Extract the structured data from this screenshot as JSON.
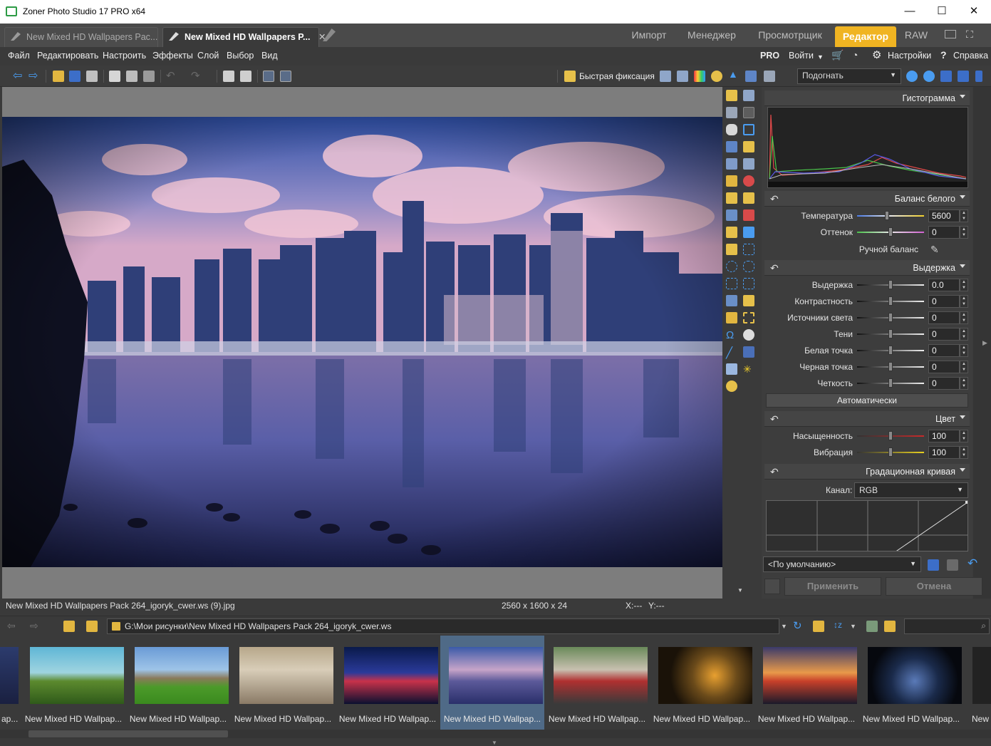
{
  "window": {
    "title": "Zoner Photo Studio 17 PRO x64",
    "minimize": "—",
    "maximize": "☐",
    "close": "✕"
  },
  "doc_tabs": [
    {
      "label": "New Mixed HD Wallpapers Pac..."
    },
    {
      "label": "New Mixed HD Wallpapers P...",
      "close": "✕"
    }
  ],
  "module_tabs": [
    "Импорт",
    "Менеджер",
    "Просмотрщик",
    "Редактор",
    "RAW"
  ],
  "menu": [
    "Файл",
    "Редактировать",
    "Настроить",
    "Эффекты",
    "Слой",
    "Выбор",
    "Вид"
  ],
  "account": {
    "pro": "PRO",
    "login": "Войти",
    "settings": "Настройки",
    "help": "Справка"
  },
  "toolbar": {
    "quick_fix": "Быстрая фиксация",
    "fit_mode": "Подогнать"
  },
  "panels": {
    "histogram": {
      "title": "Гистограмма"
    },
    "white_balance": {
      "title": "Баланс белого",
      "rows": [
        {
          "label": "Температура",
          "value": "5600",
          "level": 0.45
        },
        {
          "label": "Оттенок",
          "value": "0",
          "level": 0.5
        }
      ],
      "manual": "Ручной баланс"
    },
    "exposure": {
      "title": "Выдержка",
      "rows": [
        {
          "label": "Выдержка",
          "value": "0.0",
          "level": 0.5
        },
        {
          "label": "Контрастность",
          "value": "0",
          "level": 0.5
        },
        {
          "label": "Источники света",
          "value": "0",
          "level": 0.5
        },
        {
          "label": "Тени",
          "value": "0",
          "level": 0.5
        },
        {
          "label": "Белая точка",
          "value": "0",
          "level": 0.5
        },
        {
          "label": "Черная точка",
          "value": "0",
          "level": 0.5
        },
        {
          "label": "Четкость",
          "value": "0",
          "level": 0.5
        }
      ],
      "auto": "Автоматически"
    },
    "color": {
      "title": "Цвет",
      "rows": [
        {
          "label": "Насыщенность",
          "value": "100",
          "level": 0.5
        },
        {
          "label": "Вибрация",
          "value": "100",
          "level": 0.5
        }
      ]
    },
    "curves": {
      "title": "Градационная кривая",
      "channel_label": "Канал:",
      "channel": "RGB"
    }
  },
  "preset": {
    "value": "<По умолчанию>"
  },
  "actions": {
    "apply": "Применить",
    "cancel": "Отмена"
  },
  "status": {
    "filename": "New Mixed HD Wallpapers Pack 264_igoryk_cwer.ws (9).jpg",
    "dimensions": "2560 x 1600 x 24",
    "x": "X:---",
    "y": "Y:---"
  },
  "path": "G:\\Мои рисунки\\New Mixed HD Wallpapers Pack 264_igoryk_cwer.ws",
  "thumbnails": [
    {
      "caption": "New Mixed HD Wallpap..."
    },
    {
      "caption": "New Mixed HD Wallpap..."
    },
    {
      "caption": "New Mixed HD Wallpap..."
    },
    {
      "caption": "New Mixed HD Wallpap..."
    },
    {
      "caption": "New Mixed HD Wallpap..."
    },
    {
      "caption": "New Mixed HD Wallpap..."
    },
    {
      "caption": "New Mixed HD Wallpap..."
    },
    {
      "caption": "New Mixed HD Wallpap..."
    },
    {
      "caption": "New Mixed HD Wallpap..."
    }
  ],
  "partial_captions": {
    "left": "ap...",
    "right": "New"
  },
  "colors": {
    "accent": "#f0b422",
    "selected_thumb": "#4f6a87",
    "panel_bg": "#3d3d3d",
    "canvas_bg": "#7d7d7d"
  }
}
